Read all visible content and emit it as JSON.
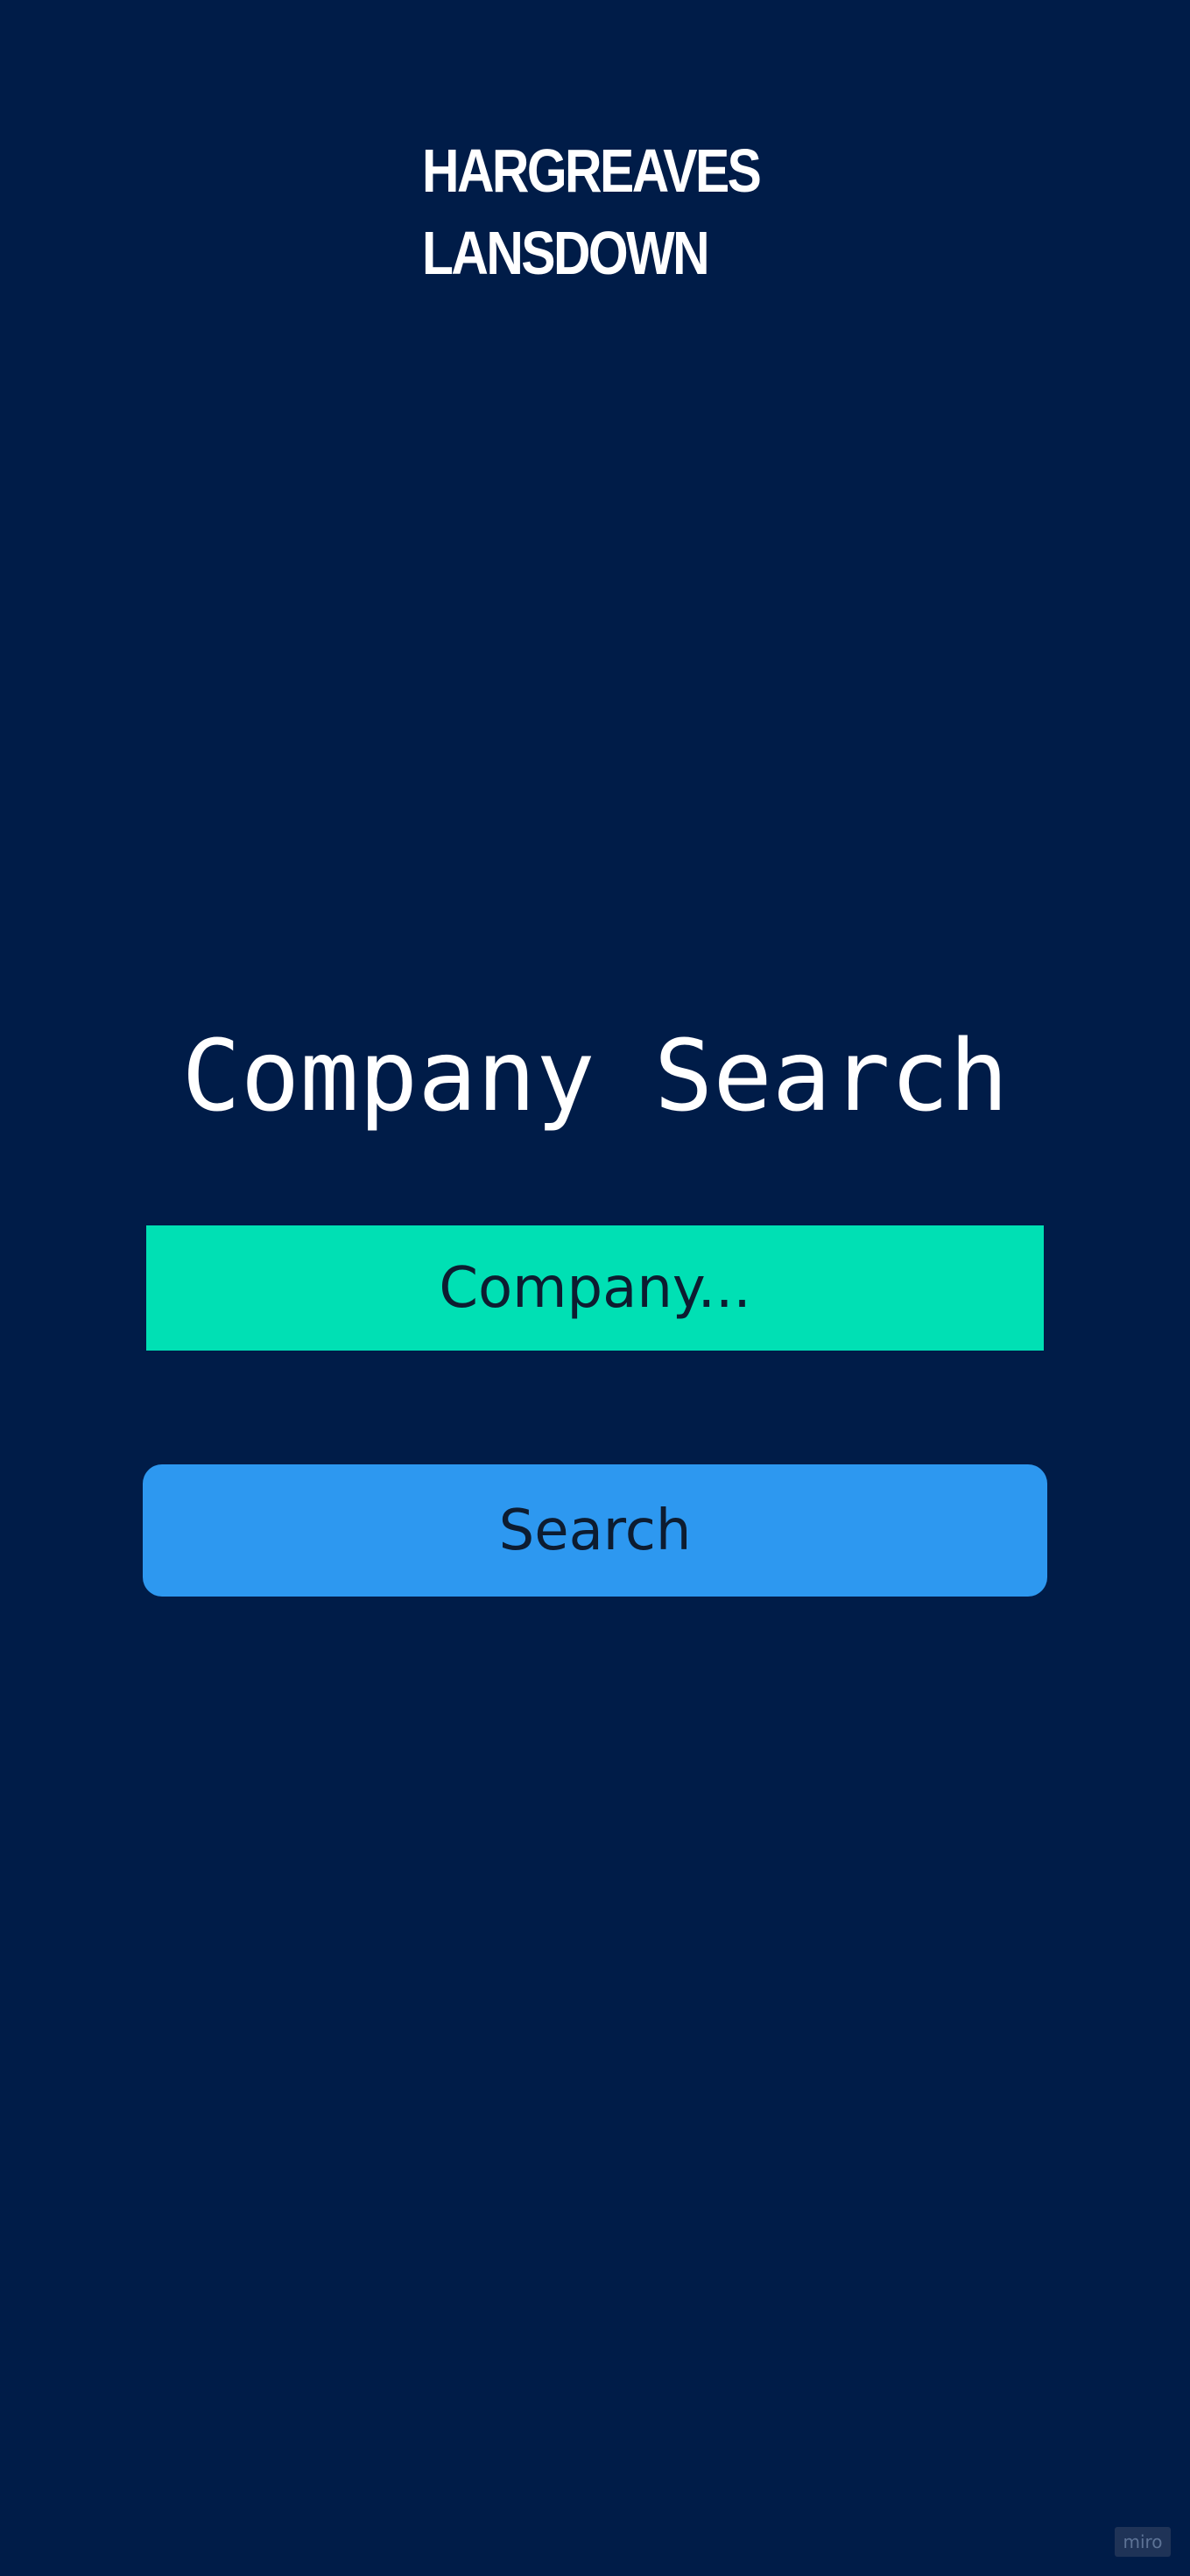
{
  "brand": {
    "logo_line_1": "HARGREAVES",
    "logo_line_2": "LANSDOWN"
  },
  "page": {
    "title": "Company Search"
  },
  "search": {
    "placeholder": "Company...",
    "value": "",
    "button_label": "Search"
  },
  "watermark": {
    "label": "miro"
  },
  "colors": {
    "background": "#001c48",
    "input_background": "#00e0b4",
    "button_background": "#2d98f0",
    "text_light": "#ffffff",
    "text_dark": "#0d1c30"
  }
}
